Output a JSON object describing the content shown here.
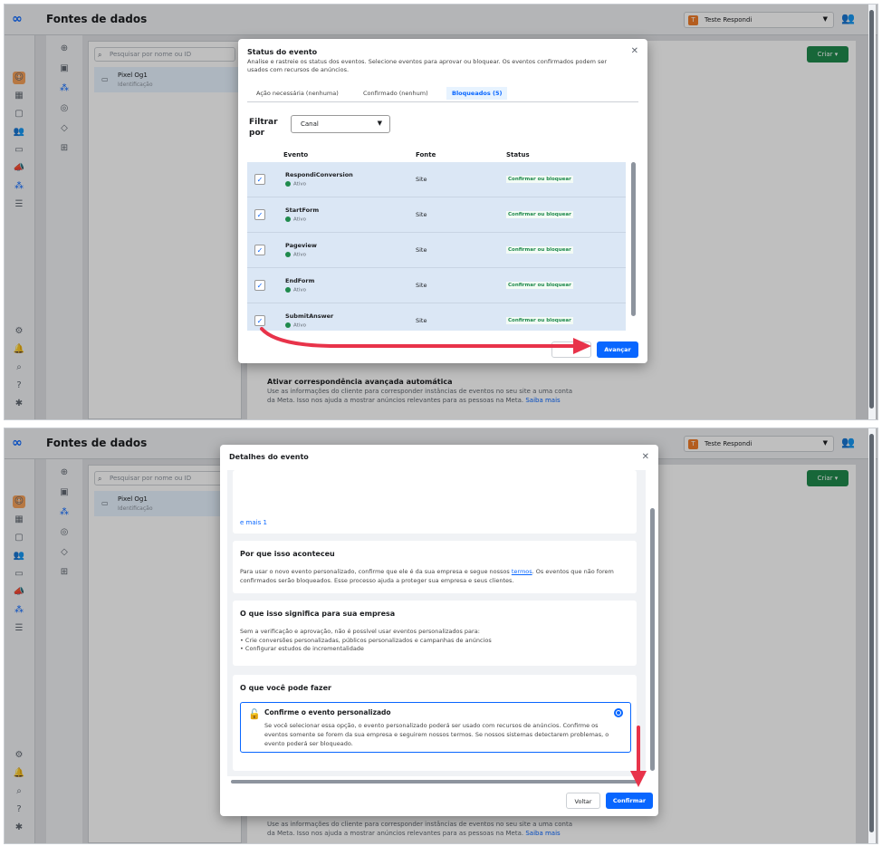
{
  "app": {
    "title": "Fontes de dados",
    "account_name": "Teste Respondi",
    "account_initial": "T",
    "biz_initial": "T"
  },
  "search": {
    "placeholder": "Pesquisar por nome ou ID"
  },
  "pixel": {
    "name": "Pixel Og1",
    "id_label": "Identificação"
  },
  "criar": "Criar",
  "background": {
    "title": "Ativar correspondência avançada automática",
    "line1": "Use as informações do cliente para corresponder instâncias de eventos no seu site a uma conta",
    "line2": "da Meta. Isso nos ajuda a mostrar anúncios relevantes para as pessoas na Meta.",
    "learn_more": "Saiba mais"
  },
  "modal1": {
    "title": "Status do evento",
    "subtitle": "Analise e rastreie os status dos eventos. Selecione eventos para aprovar ou bloquear. Os eventos confirmados podem ser usados com recursos de anúncios.",
    "tabs": [
      "Ação necessária (nenhuma)",
      "Confirmado (nenhum)",
      "Bloqueados (5)"
    ],
    "filter_label": "Filtrar por",
    "filter_value": "Canal",
    "headers": {
      "event": "Evento",
      "source": "Fonte",
      "status": "Status"
    },
    "rows": [
      {
        "name": "RespondiConversion",
        "state": "Ativo",
        "source": "Site",
        "action": "Confirmar ou bloquear"
      },
      {
        "name": "StartForm",
        "state": "Ativo",
        "source": "Site",
        "action": "Confirmar ou bloquear"
      },
      {
        "name": "Pageview",
        "state": "Ativo",
        "source": "Site",
        "action": "Confirmar ou bloquear"
      },
      {
        "name": "EndForm",
        "state": "Ativo",
        "source": "Site",
        "action": "Confirmar ou bloquear"
      },
      {
        "name": "SubmitAnswer",
        "state": "Ativo",
        "source": "Site",
        "action": "Confirmar ou bloquear"
      }
    ],
    "back_btn": "",
    "next_btn": "Avançar"
  },
  "modal2": {
    "title": "Detalhes do evento",
    "more_link": "e mais 1",
    "why": {
      "title": "Por que isso aconteceu",
      "text_pre": "Para usar o novo evento personalizado, confirme que ele é da sua empresa e segue nossos ",
      "terms": "termos",
      "text_post": ". Os eventos que não forem confirmados serão bloqueados. Esse processo ajuda a proteger sua empresa e seus clientes."
    },
    "meaning": {
      "title": "O que isso significa para sua empresa",
      "intro": "Sem a verificação e aprovação, não é possível usar eventos personalizados para:",
      "b1": "• Crie conversões personalizadas, públicos personalizados e campanhas de anúncios",
      "b2": "• Configurar estudos de incrementalidade"
    },
    "todo": {
      "title": "O que você pode fazer",
      "option_title": "Confirme o evento personalizado",
      "option_text": "Se você selecionar essa opção, o evento personalizado poderá ser usado com recursos de anúncios. Confirme os eventos somente se forem da sua empresa e seguirem nossos termos. Se nossos sistemas detectarem problemas, o evento poderá ser bloqueado."
    },
    "back_btn": "Voltar",
    "confirm_btn": "Confirmar"
  },
  "colors": {
    "accent": "#0866ff",
    "green": "#1f8a4c",
    "arrow": "#e8334a"
  },
  "icons": [
    "meta-logo-icon",
    "search-icon",
    "close-icon",
    "check-icon",
    "lock-icon",
    "gear-icon",
    "bell-icon",
    "help-icon",
    "bug-icon"
  ]
}
